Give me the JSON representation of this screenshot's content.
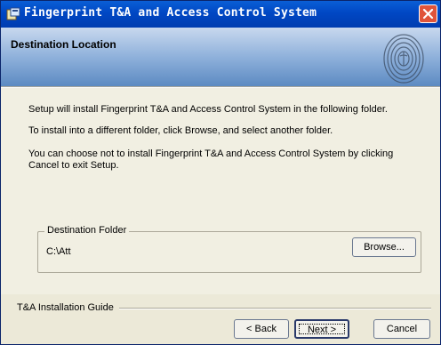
{
  "window": {
    "title": "Fingerprint T&A and Access Control System"
  },
  "header": {
    "heading": "Destination Location"
  },
  "body": {
    "para1": "Setup will install Fingerprint T&A and Access Control System in the following folder.",
    "para2": "To install into a different folder, click Browse, and select another folder.",
    "para3": "You can choose not to install Fingerprint T&A and Access Control System by clicking Cancel to exit Setup."
  },
  "destination": {
    "legend": "Destination Folder",
    "path": "C:\\Att",
    "browse_label": "Browse..."
  },
  "footer": {
    "guide_label": "T&A Installation Guide",
    "back_label": "< Back",
    "next_label": "Next >",
    "cancel_label": "Cancel"
  },
  "icons": {
    "app": "setup-app-icon",
    "close": "close-icon",
    "header_graphic": "fingerprint-icon"
  },
  "colors": {
    "titlebar": "#0047c4",
    "close": "#e0543a",
    "header_gradient_end": "#5c8ac2"
  }
}
